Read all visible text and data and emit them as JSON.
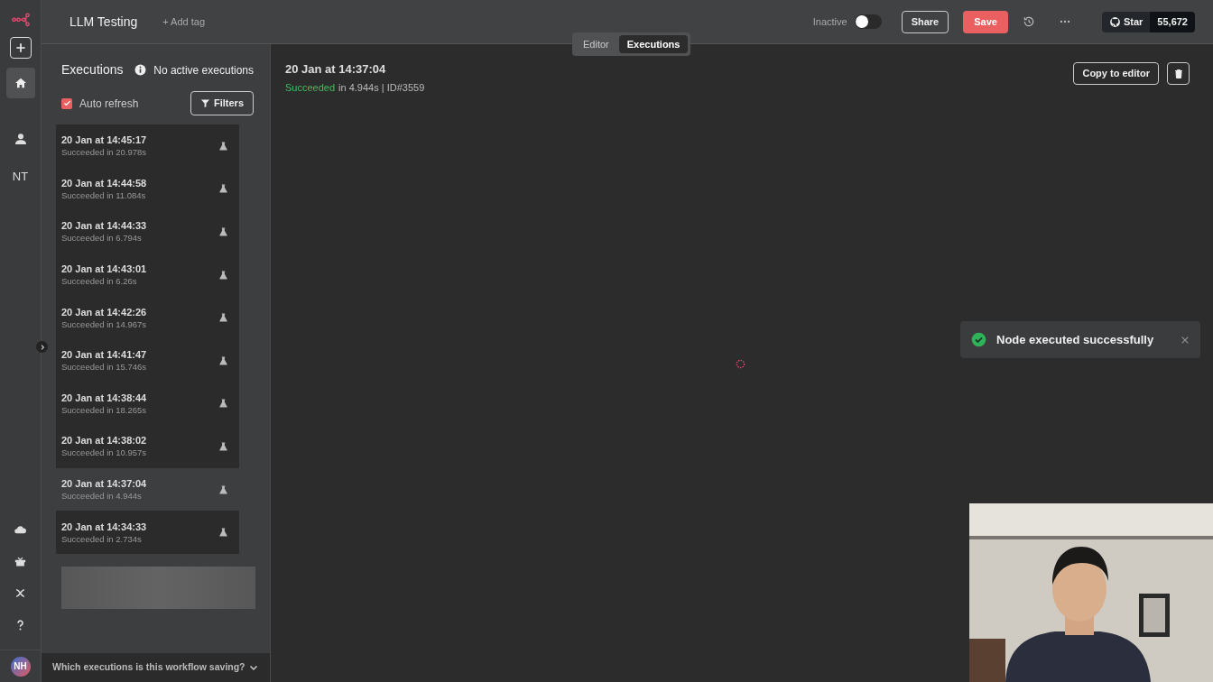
{
  "rail": {
    "items": [
      {
        "kind": "plus",
        "selected": false
      },
      {
        "kind": "home",
        "selected": true
      },
      {
        "kind": "user",
        "selected": false
      },
      {
        "kind": "text",
        "label": "NT",
        "selected": false
      }
    ],
    "bottom": [
      {
        "kind": "cloud"
      },
      {
        "kind": "box"
      },
      {
        "kind": "variable"
      },
      {
        "kind": "help"
      }
    ],
    "avatar": "NH"
  },
  "header": {
    "title": "LLM Testing",
    "add_tag": "+ Add tag",
    "active_label": "Inactive",
    "active": false,
    "share": "Share",
    "save": "Save",
    "star": "Star",
    "star_count": "55,672"
  },
  "view_tabs": [
    {
      "label": "Editor",
      "selected": false
    },
    {
      "label": "Executions",
      "selected": true
    }
  ],
  "executions": {
    "title": "Executions",
    "status": "No active executions",
    "auto_refresh": {
      "label": "Auto refresh",
      "checked": true
    },
    "filters": "Filters",
    "items": [
      {
        "time": "20 Jan at 14:45:17",
        "result": "Succeeded in 20.978s",
        "selected": false
      },
      {
        "time": "20 Jan at 14:44:58",
        "result": "Succeeded in 11.084s",
        "selected": false
      },
      {
        "time": "20 Jan at 14:44:33",
        "result": "Succeeded in 6.794s",
        "selected": false
      },
      {
        "time": "20 Jan at 14:43:01",
        "result": "Succeeded in 6.26s",
        "selected": false
      },
      {
        "time": "20 Jan at 14:42:26",
        "result": "Succeeded in 14.967s",
        "selected": false
      },
      {
        "time": "20 Jan at 14:41:47",
        "result": "Succeeded in 15.746s",
        "selected": false
      },
      {
        "time": "20 Jan at 14:38:44",
        "result": "Succeeded in 18.265s",
        "selected": false
      },
      {
        "time": "20 Jan at 14:38:02",
        "result": "Succeeded in 10.957s",
        "selected": false
      },
      {
        "time": "20 Jan at 14:37:04",
        "result": "Succeeded in 4.944s",
        "selected": true
      },
      {
        "time": "20 Jan at 14:34:33",
        "result": "Succeeded in 2.734s",
        "selected": false
      }
    ],
    "footer": "Which executions is this workflow saving?"
  },
  "detail": {
    "title": "20 Jan at 14:37:04",
    "status": "Succeeded",
    "info": "in 4.944s | ID#3559",
    "copy": "Copy to editor"
  },
  "toast": {
    "message": "Node executed successfully"
  }
}
